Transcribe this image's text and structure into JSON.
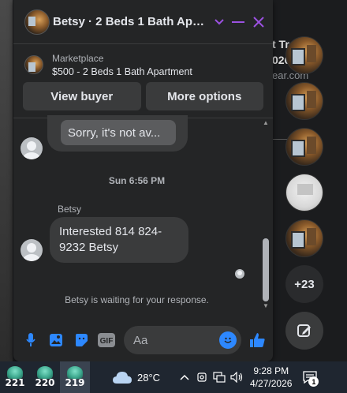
{
  "background": {
    "line1": "t Tr",
    "line2": "026",
    "line3": "ear.com"
  },
  "chat": {
    "title": "Betsy · 2 Beds 1 Bath Apartment",
    "listing": {
      "label": "Marketplace",
      "title": "$500 - 2 Beds 1 Bath Apartment"
    },
    "buttons": {
      "view_buyer": "View buyer",
      "more_options": "More options"
    },
    "quoted_message": "Sorry, it's not av...",
    "timestamp": "Sun 6:56 PM",
    "sender": "Betsy",
    "message": "Interested 814 824-9232 Betsy",
    "waiting": "Betsy is waiting for your response.",
    "composer": {
      "placeholder": "Aa",
      "gif_label": "GIF"
    },
    "accent_color": "#9b51e0"
  },
  "chat_heads": {
    "more_count": "+23"
  },
  "taskbar": {
    "apps": [
      {
        "number": "221"
      },
      {
        "number": "220"
      },
      {
        "number": "219"
      }
    ],
    "weather": "28°C",
    "time": "9:28 PM",
    "date": "4/27/2026",
    "notifications": "1"
  }
}
